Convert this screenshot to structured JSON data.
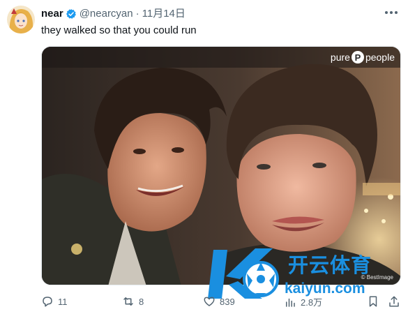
{
  "post": {
    "author_name": "near",
    "author_handle": "@nearcyan",
    "separator": "·",
    "date": "11月14日",
    "text": "they walked so that you could run"
  },
  "media": {
    "watermark_top": "pure",
    "watermark_top_suffix": "people",
    "watermark_top_logo": "P",
    "watermark_bottom": "© BestImage"
  },
  "overlay": {
    "brand_cn": "开云体育",
    "brand_url": "kaiyun.com"
  },
  "actions": {
    "replies": "11",
    "reposts": "8",
    "likes": "839",
    "views": "2.8万"
  },
  "colors": {
    "text_primary": "#0f1419",
    "text_secondary": "#536471",
    "verified": "#1d9bf0",
    "overlay_brand": "#1a8fe0"
  },
  "icons": {
    "more": "more-dots-icon",
    "verified": "verified-badge-icon",
    "reply": "reply-icon",
    "repost": "repost-icon",
    "like": "heart-icon",
    "views": "views-chart-icon",
    "bookmark": "bookmark-icon",
    "share": "share-icon"
  }
}
